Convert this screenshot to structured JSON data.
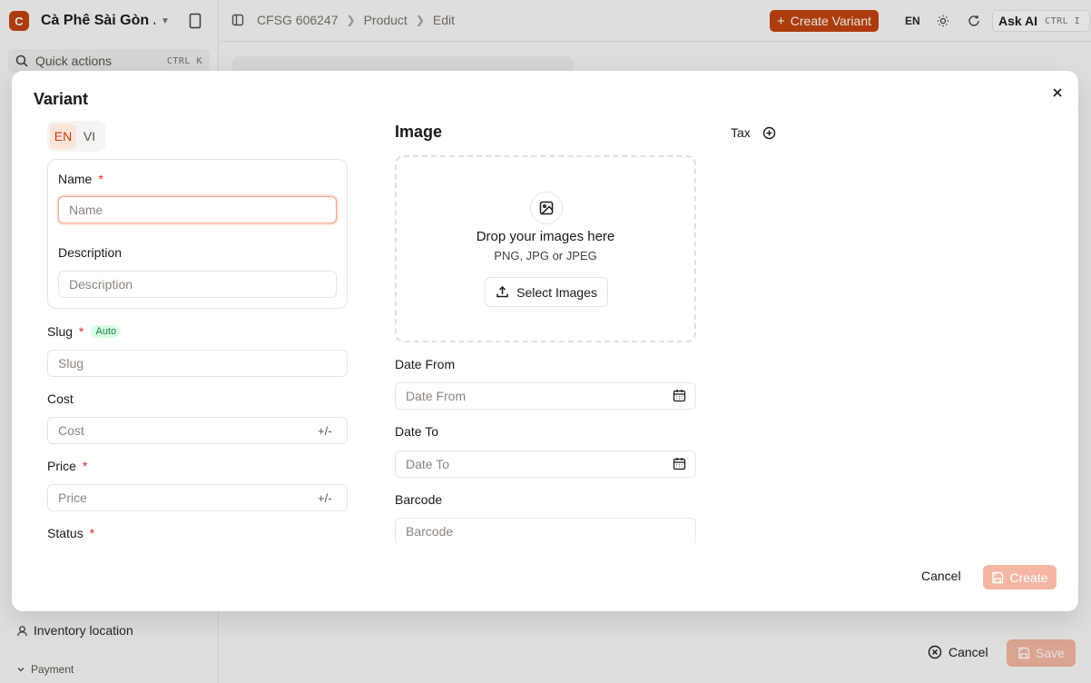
{
  "sidebar": {
    "brand_initial": "C",
    "brand_name": "Cà Phê Sài Gòn ...",
    "quick_actions": "Quick actions",
    "quick_shortcut": "CTRL K",
    "inventory_location": "Inventory location",
    "payment_group": "Payment"
  },
  "topbar": {
    "crumb_1": "CFSG 606247",
    "crumb_2": "Product",
    "crumb_3": "Edit",
    "create_variant": "Create Variant",
    "lang": "EN",
    "ask_ai": "Ask AI",
    "ask_ai_shortcut": "CTRL I"
  },
  "page": {
    "cancel": "Cancel",
    "save": "Save"
  },
  "modal": {
    "title": "Variant",
    "lang_tabs": [
      "EN",
      "VI"
    ],
    "active_lang": "EN",
    "name": {
      "label": "Name",
      "placeholder": "Name",
      "value": ""
    },
    "description": {
      "label": "Description",
      "placeholder": "Description"
    },
    "slug": {
      "label": "Slug",
      "badge": "Auto",
      "placeholder": "Slug"
    },
    "cost": {
      "label": "Cost",
      "placeholder": "Cost",
      "suffix": "+/-"
    },
    "price": {
      "label": "Price",
      "placeholder": "Price",
      "suffix": "+/-"
    },
    "status": {
      "label": "Status"
    },
    "image": {
      "title": "Image",
      "drop_title": "Drop your images here",
      "drop_sub": "PNG, JPG or JPEG",
      "select_button": "Select Images"
    },
    "date_from": {
      "label": "Date From",
      "placeholder": "Date From"
    },
    "date_to": {
      "label": "Date To",
      "placeholder": "Date To"
    },
    "barcode": {
      "label": "Barcode",
      "placeholder": "Barcode"
    },
    "tax": {
      "label": "Tax"
    },
    "cancel": "Cancel",
    "create": "Create"
  },
  "colors": {
    "accent": "#c2410c",
    "accent_disabled": "#f5b7a3",
    "required": "#dc2626",
    "auto_badge": "#15803d"
  }
}
